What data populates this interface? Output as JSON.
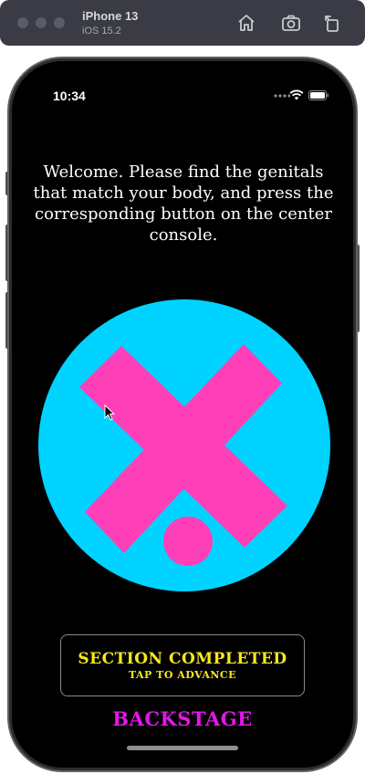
{
  "simulator": {
    "device_name": "iPhone 13",
    "os_version": "iOS 15.2",
    "icons": [
      "home-icon",
      "screenshot-icon",
      "rotate-icon"
    ]
  },
  "status_bar": {
    "time": "10:34",
    "icons": [
      "signal-dots-icon",
      "wifi-icon",
      "battery-icon"
    ]
  },
  "screen": {
    "welcome_text": "Welcome. Please find the genitals that match your body, and press the corresponding button on the center console.",
    "graphic": {
      "circle_color": "#00d3ff",
      "mark_color": "#ff3fb8",
      "icon": "x-mark-with-dot-icon"
    },
    "section_button": {
      "title": "SECTION COMPLETED",
      "subtitle": "TAP TO ADVANCE",
      "text_color": "#f7e81d"
    },
    "backstage_label": "BACKSTAGE",
    "backstage_color": "#e217e8"
  }
}
